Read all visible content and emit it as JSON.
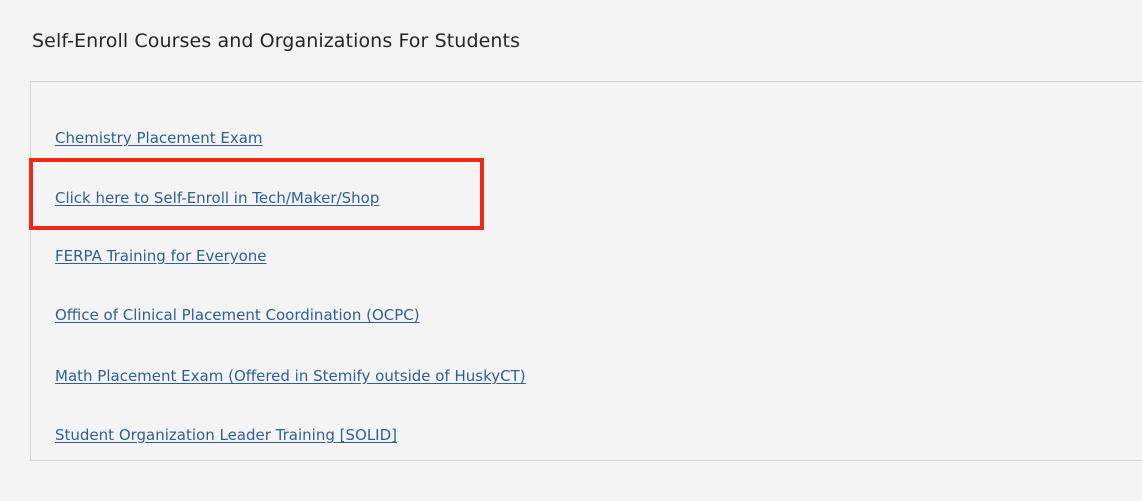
{
  "module": {
    "title": "Self-Enroll Courses and Organizations For Students",
    "links": [
      "Chemistry Placement Exam",
      "Click here to Self-Enroll in Tech/Maker/Shop",
      "FERPA Training for Everyone",
      "Office of Clinical Placement Coordination (OCPC)",
      "Math Placement Exam (Offered in Stemify outside of HuskyCT)",
      "Student Organization Leader Training [SOLID]"
    ]
  },
  "colors": {
    "link": "#2e5f9a",
    "highlight": "#ee2a16",
    "background": "#f3f3f3",
    "border": "#d2d2d2"
  }
}
